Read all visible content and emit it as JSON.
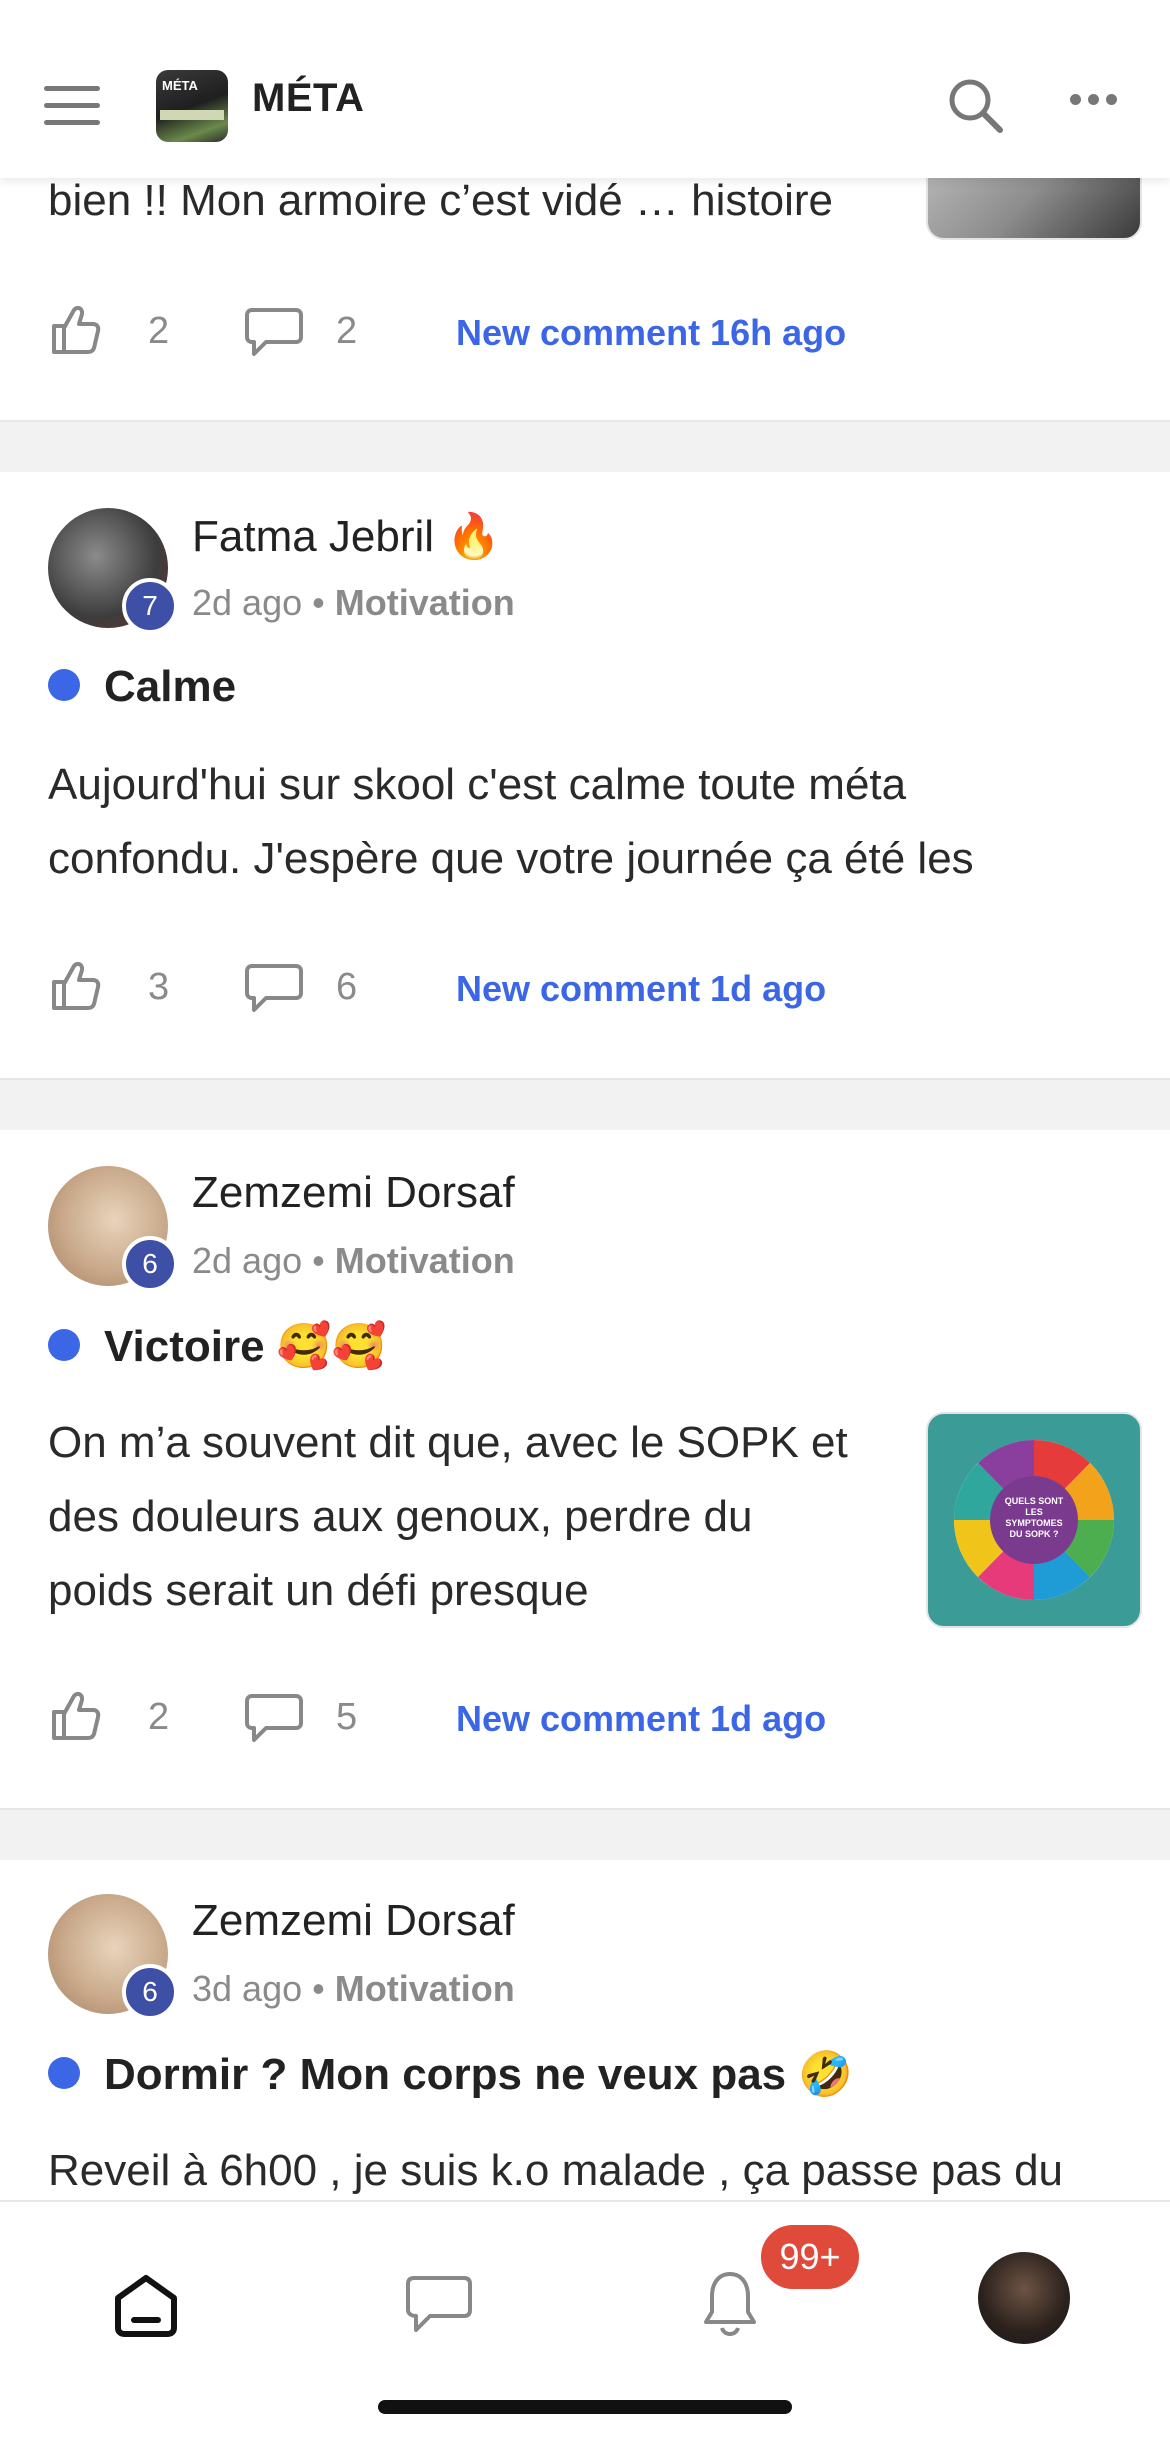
{
  "header": {
    "title": "MÉTA",
    "logo_text": "MÉTA"
  },
  "posts": [
    {
      "body": "bien !! Mon armoire c’est vidé … histoire",
      "likes": "2",
      "comments": "2",
      "new_comment": "New comment 16h ago"
    },
    {
      "author": "Fatma Jebril",
      "author_emoji": "🔥",
      "level": "7",
      "time": "2d ago",
      "separator": "•",
      "category": "Motivation",
      "title": "Calme",
      "body_line1": "Aujourd'hui sur skool c'est calme toute méta",
      "body_line2": "confondu. J'espère que votre journée ça été les",
      "likes": "3",
      "comments": "6",
      "new_comment": "New comment 1d ago"
    },
    {
      "author": "Zemzemi Dorsaf",
      "level": "6",
      "time": "2d ago",
      "separator": "•",
      "category": "Motivation",
      "title": "Victoire",
      "title_emoji": "🥰🥰",
      "body_line1": "On m’a souvent dit que, avec le SOPK et",
      "body_line2": "des douleurs aux genoux, perdre du",
      "body_line3": "poids serait un défi presque",
      "thumb_text": "QUELS SONT LES SYMPTOMES DU SOPK ?",
      "likes": "2",
      "comments": "5",
      "new_comment": "New comment 1d ago"
    },
    {
      "author": "Zemzemi Dorsaf",
      "level": "6",
      "time": "3d ago",
      "separator": "•",
      "category": "Motivation",
      "title": "Dormir ? Mon corps ne veux pas",
      "title_emoji": "🤣",
      "body_line1": "Reveil à 6h00 , je suis k.o malade , ça passe pas du"
    }
  ],
  "tabbar": {
    "notifications_badge": "99+",
    "icons": [
      "home-icon",
      "chat-icon",
      "bell-icon",
      "profile-avatar"
    ]
  },
  "colors": {
    "accent": "#3b66e6",
    "badge": "#3e4fa6",
    "notification": "#e04a3a"
  }
}
